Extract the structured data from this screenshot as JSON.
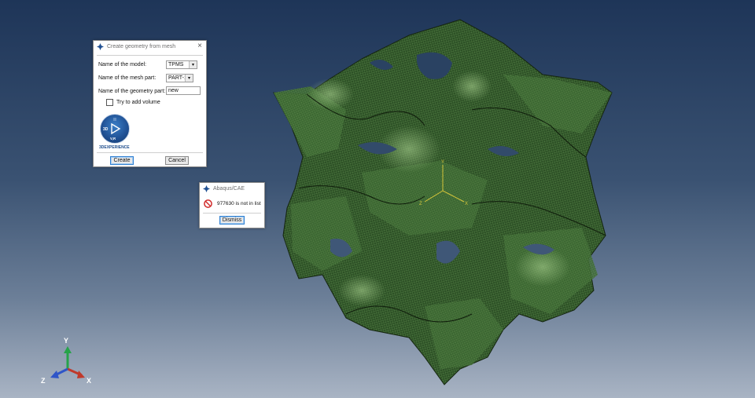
{
  "create_dialog": {
    "title": "Create geometry from mesh",
    "model_label": "Name of the model:",
    "model_value": "TPMS",
    "mesh_part_label": "Name of the mesh part:",
    "mesh_part_value": "PART-1",
    "geometry_part_label": "Name of the geometry part:",
    "geometry_part_value": "new",
    "volume_checkbox_label": "Try to add volume",
    "volume_checked": false,
    "brand_badge_top": "3D",
    "brand_badge_version": "V,R",
    "brand_text": "3DEXPERIENCE",
    "create_button": "Create",
    "cancel_button": "Cancel"
  },
  "error_dialog": {
    "title": "Abaqus/CAE",
    "message": "977630 is not in list",
    "dismiss_button": "Dismiss"
  },
  "triad": {
    "x": "X",
    "y": "Y",
    "z": "Z"
  },
  "colors": {
    "mesh": "#2e5226",
    "mesh_light": "#4c7a3e",
    "axis_x": "#c0392b",
    "axis_y": "#27a34a",
    "axis_z": "#2f55c8"
  }
}
